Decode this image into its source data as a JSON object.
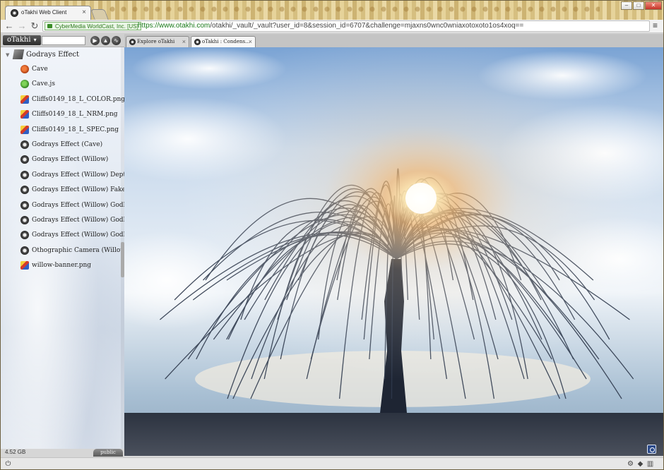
{
  "browser": {
    "tab_title": "oTakhi Web Client",
    "cert_label": "CyberMedia WorldCast, Inc. [US]",
    "url_host": "https://www.otakhi.com",
    "url_path": "/otakhi/_vault/_vault?user_id=8&session_id=6707&challenge=mjaxns0wnc0wniaxotoxoto1os4xoq=="
  },
  "app": {
    "brand": "oTakhi",
    "brand_caret": "▾",
    "search_placeholder": "",
    "tree": {
      "root": "Godrays Effect",
      "items": [
        {
          "label": "Cave",
          "type": "scene"
        },
        {
          "label": "Cave.js",
          "type": "js"
        },
        {
          "label": "Cliffs0149_18_L_COLOR.png",
          "type": "img"
        },
        {
          "label": "Cliffs0149_18_L_NRM.png",
          "type": "img"
        },
        {
          "label": "Cliffs0149_18_L_SPEC.png",
          "type": "img"
        },
        {
          "label": "Godrays Effect (Cave)",
          "type": "obj"
        },
        {
          "label": "Godrays Effect (Willow)",
          "type": "obj"
        },
        {
          "label": "Godrays Effect (Willow) Depth N",
          "type": "obj"
        },
        {
          "label": "Godrays Effect (Willow) FakeSu",
          "type": "obj"
        },
        {
          "label": "Godrays Effect (Willow) GodRay",
          "type": "obj"
        },
        {
          "label": "Godrays Effect (Willow) GodRay",
          "type": "obj"
        },
        {
          "label": "Godrays Effect (Willow) GodRa",
          "type": "obj"
        },
        {
          "label": "Othographic Camera (Willow) D",
          "type": "obj"
        },
        {
          "label": "willow-banner.png",
          "type": "img"
        }
      ]
    },
    "storage": "4.52 GB",
    "visibility": "public",
    "tabs": [
      {
        "label": "Explore oTakhi"
      },
      {
        "label": "oTakhi : Condens..."
      }
    ]
  },
  "colors": {
    "sky_top": "#6f9bcf",
    "sun": "#fff2c9",
    "tree": "#2f3a4d",
    "ground": "#3b414d"
  }
}
